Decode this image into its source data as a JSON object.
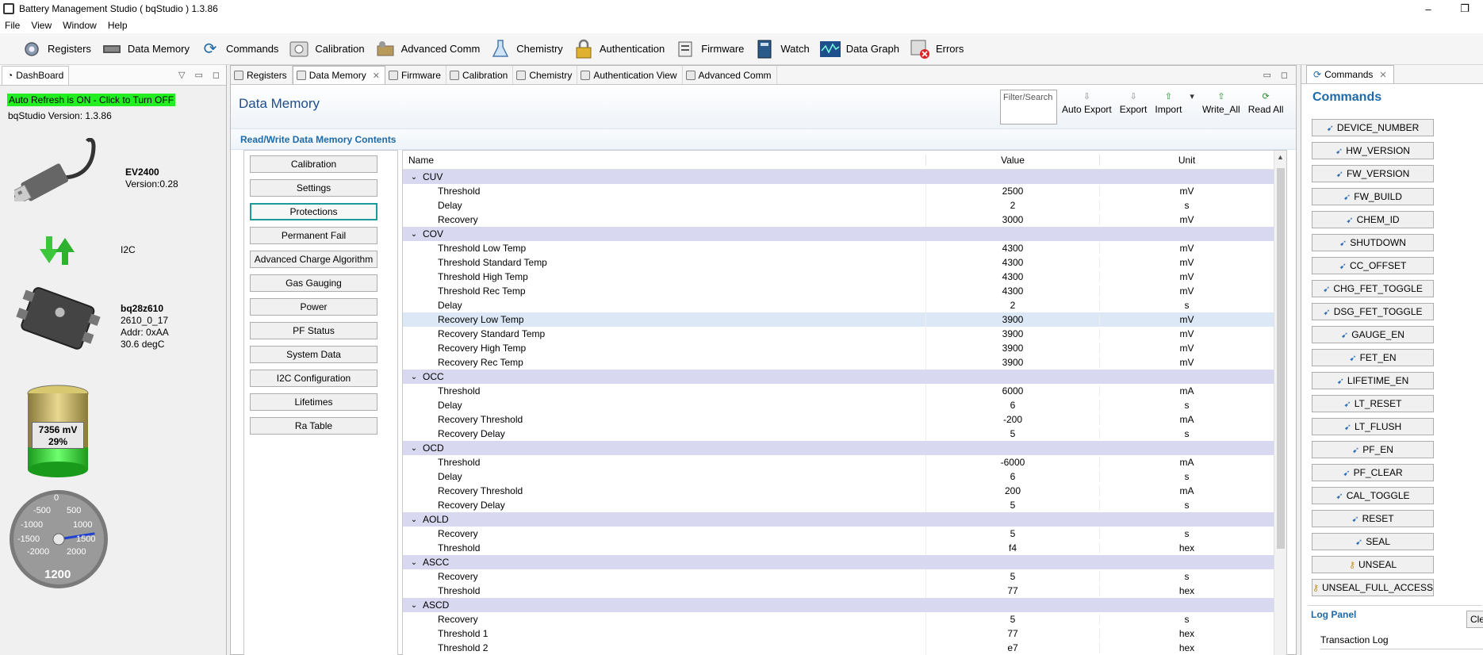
{
  "window": {
    "title": "Battery Management Studio ( bqStudio ) 1.3.86",
    "minimize": "–",
    "restore": "❐"
  },
  "menu": [
    "File",
    "View",
    "Window",
    "Help"
  ],
  "toolbar": [
    {
      "label": "Registers",
      "icon": "gear-icon"
    },
    {
      "label": "Data Memory",
      "icon": "chip-icon"
    },
    {
      "label": "Commands",
      "icon": "refresh-icon"
    },
    {
      "label": "Calibration",
      "icon": "calibration-icon"
    },
    {
      "label": "Advanced Comm",
      "icon": "comm-icon"
    },
    {
      "label": "Chemistry",
      "icon": "flask-icon"
    },
    {
      "label": "Authentication",
      "icon": "lock-icon"
    },
    {
      "label": "Firmware",
      "icon": "firmware-icon"
    },
    {
      "label": "Watch",
      "icon": "book-icon"
    },
    {
      "label": "Data Graph",
      "icon": "graph-icon"
    },
    {
      "label": "Errors",
      "icon": "error-icon"
    }
  ],
  "dashboard": {
    "tab": "DashBoard",
    "auto_refresh": "Auto Refresh is ON - Click to Turn OFF",
    "version": "bqStudio Version:  1.3.86",
    "adapter": {
      "name": "EV2400",
      "version": "Version:0.28"
    },
    "bus": "I2C",
    "device": {
      "name": "bq28z610",
      "fw": "2610_0_17",
      "addr": "Addr: 0xAA",
      "temp": "30.6 degC"
    },
    "battery": {
      "voltage": "7356 mV",
      "percent": "29%",
      "level": 0.29
    },
    "gauge": {
      "value": "1200",
      "ticks": [
        "-2000",
        "-1500",
        "-1000",
        "-500",
        "0",
        "500",
        "1000",
        "1500",
        "2000"
      ],
      "needle_value": 1200
    }
  },
  "editor": {
    "tabs": [
      "Registers",
      "Data Memory",
      "Firmware",
      "Calibration",
      "Chemistry",
      "Authentication View",
      "Advanced Comm"
    ],
    "active_tab": "Data Memory",
    "title": "Data Memory",
    "filter_placeholder": "Filter/Search",
    "actions": [
      "Auto Export",
      "Export",
      "Import",
      "Write_All",
      "Read All"
    ],
    "section": "Read/Write Data Memory Contents",
    "classes": [
      "Calibration",
      "Settings",
      "Protections",
      "Permanent Fail",
      "Advanced Charge Algorithm",
      "Gas Gauging",
      "Power",
      "PF Status",
      "System Data",
      "I2C Configuration",
      "Lifetimes",
      "Ra Table"
    ],
    "selected_class": "Protections",
    "columns": {
      "name": "Name",
      "value": "Value",
      "unit": "Unit"
    },
    "groups": [
      {
        "name": "CUV",
        "rows": [
          {
            "name": "Threshold",
            "value": "2500",
            "unit": "mV"
          },
          {
            "name": "Delay",
            "value": "2",
            "unit": "s"
          },
          {
            "name": "Recovery",
            "value": "3000",
            "unit": "mV"
          }
        ]
      },
      {
        "name": "COV",
        "rows": [
          {
            "name": "Threshold Low Temp",
            "value": "4300",
            "unit": "mV"
          },
          {
            "name": "Threshold Standard Temp",
            "value": "4300",
            "unit": "mV"
          },
          {
            "name": "Threshold High Temp",
            "value": "4300",
            "unit": "mV"
          },
          {
            "name": "Threshold Rec Temp",
            "value": "4300",
            "unit": "mV"
          },
          {
            "name": "Delay",
            "value": "2",
            "unit": "s"
          },
          {
            "name": "Recovery Low Temp",
            "value": "3900",
            "unit": "mV",
            "hl": true
          },
          {
            "name": "Recovery Standard Temp",
            "value": "3900",
            "unit": "mV"
          },
          {
            "name": "Recovery High Temp",
            "value": "3900",
            "unit": "mV"
          },
          {
            "name": "Recovery Rec Temp",
            "value": "3900",
            "unit": "mV"
          }
        ]
      },
      {
        "name": "OCC",
        "rows": [
          {
            "name": "Threshold",
            "value": "6000",
            "unit": "mA"
          },
          {
            "name": "Delay",
            "value": "6",
            "unit": "s"
          },
          {
            "name": "Recovery Threshold",
            "value": "-200",
            "unit": "mA"
          },
          {
            "name": "Recovery Delay",
            "value": "5",
            "unit": "s"
          }
        ]
      },
      {
        "name": "OCD",
        "rows": [
          {
            "name": "Threshold",
            "value": "-6000",
            "unit": "mA"
          },
          {
            "name": "Delay",
            "value": "6",
            "unit": "s"
          },
          {
            "name": "Recovery Threshold",
            "value": "200",
            "unit": "mA"
          },
          {
            "name": "Recovery Delay",
            "value": "5",
            "unit": "s"
          }
        ]
      },
      {
        "name": "AOLD",
        "rows": [
          {
            "name": "Recovery",
            "value": "5",
            "unit": "s"
          },
          {
            "name": "Threshold",
            "value": "f4",
            "unit": "hex"
          }
        ]
      },
      {
        "name": "ASCC",
        "rows": [
          {
            "name": "Recovery",
            "value": "5",
            "unit": "s"
          },
          {
            "name": "Threshold",
            "value": "77",
            "unit": "hex"
          }
        ]
      },
      {
        "name": "ASCD",
        "rows": [
          {
            "name": "Recovery",
            "value": "5",
            "unit": "s"
          },
          {
            "name": "Threshold 1",
            "value": "77",
            "unit": "hex"
          },
          {
            "name": "Threshold 2",
            "value": "e7",
            "unit": "hex"
          }
        ]
      }
    ]
  },
  "commands": {
    "tab": "Commands",
    "title": "Commands",
    "buttons": [
      "DEVICE_NUMBER",
      "HW_VERSION",
      "FW_VERSION",
      "FW_BUILD",
      "CHEM_ID",
      "SHUTDOWN",
      "CC_OFFSET",
      "CHG_FET_TOGGLE",
      "DSG_FET_TOGGLE",
      "GAUGE_EN",
      "FET_EN",
      "LIFETIME_EN",
      "LT_RESET",
      "LT_FLUSH",
      "PF_EN",
      "PF_CLEAR",
      "CAL_TOGGLE",
      "RESET",
      "SEAL",
      "UNSEAL",
      "UNSEAL_FULL_ACCESS"
    ],
    "log_title": "Log Panel",
    "clear": "Cle",
    "transaction_log": "Transaction Log"
  },
  "colors": {
    "accent": "#1e6aa8",
    "refresh_green": "#22ee22",
    "group_row": "#d8d8f0",
    "selected_border": "#1e9a9a"
  }
}
